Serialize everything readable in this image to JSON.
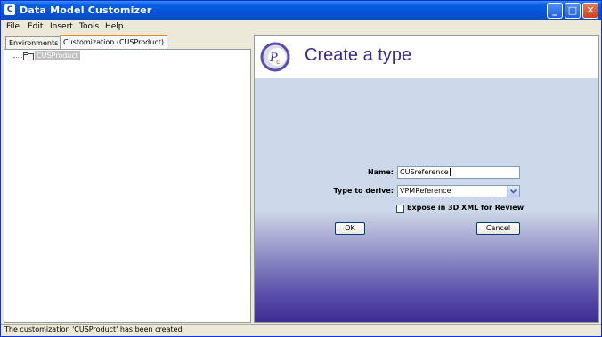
{
  "window": {
    "title": "Data Model Customizer",
    "minimize_glyph": "_",
    "maximize_glyph": "□",
    "close_glyph": "✕",
    "app_icon_glyph": "C"
  },
  "menu": [
    "File",
    "Edit",
    "Insert",
    "Tools",
    "Help"
  ],
  "left_panel": {
    "tabs": [
      {
        "label": "Environments",
        "active": false
      },
      {
        "label": "Customization (CUSProduct)",
        "active": true
      }
    ],
    "tree": [
      {
        "label": "CUSProduct",
        "icon": "folder-icon",
        "selected": true
      }
    ]
  },
  "right_panel": {
    "title": "Create a type",
    "logo_icon": "customizer-logo-icon",
    "form": {
      "name_label": "Name:",
      "name_value": "CUSreference",
      "type_label": "Type to derive:",
      "type_value": "VPMReference",
      "checkbox_label": "Expose in 3D XML for Review",
      "checkbox_checked": false,
      "ok_label": "OK",
      "cancel_label": "Cancel"
    }
  },
  "status": {
    "text": "The customization 'CUSProduct' has been created"
  },
  "colors": {
    "title_bar": "#0653d6",
    "heading": "#3b2a8a",
    "form_top": "#cdd8ea",
    "form_bottom": "#3c2a92"
  }
}
